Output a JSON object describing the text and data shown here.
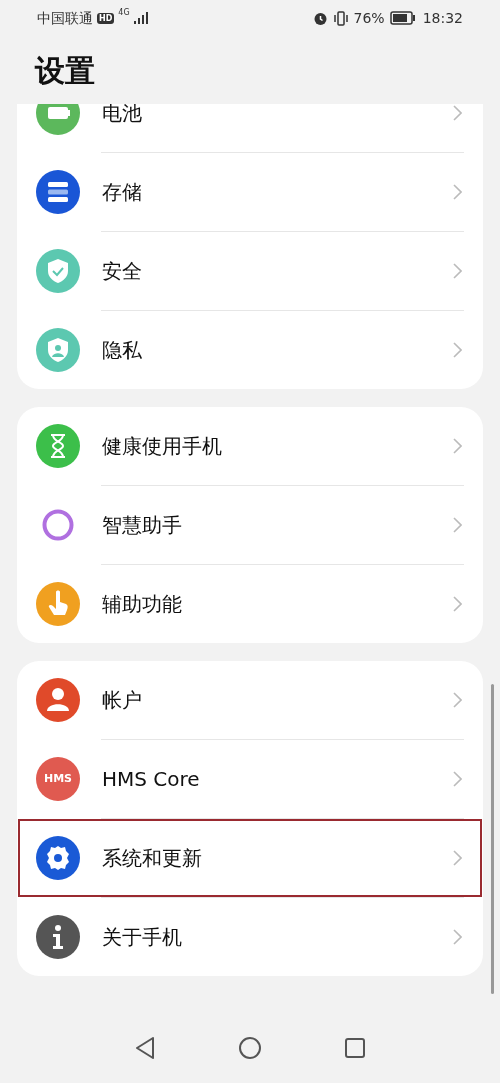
{
  "status_bar": {
    "carrier": "中国联通",
    "hd_badge": "HD",
    "network": "4G",
    "battery_percent": "76%",
    "time": "18:32"
  },
  "title": "设置",
  "groups": [
    {
      "items": [
        {
          "label": "电池",
          "kind": "battery",
          "color": "#5cb85c",
          "highlighted": false
        },
        {
          "label": "存储",
          "kind": "storage",
          "color": "#1a56d6",
          "highlighted": false
        },
        {
          "label": "安全",
          "kind": "shield",
          "color": "#5cc8b0",
          "highlighted": false
        },
        {
          "label": "隐私",
          "kind": "privacy",
          "color": "#5cc8b0",
          "highlighted": false
        }
      ]
    },
    {
      "items": [
        {
          "label": "健康使用手机",
          "kind": "hourglass",
          "color": "#3cbf4a",
          "highlighted": false
        },
        {
          "label": "智慧助手",
          "kind": "ring",
          "color": "#b070e0",
          "highlighted": false
        },
        {
          "label": "辅助功能",
          "kind": "hand",
          "color": "#f0a020",
          "highlighted": false
        }
      ]
    },
    {
      "items": [
        {
          "label": "帐户",
          "kind": "person",
          "color": "#e04a2a",
          "highlighted": false
        },
        {
          "label": "HMS Core",
          "kind": "hms",
          "icon_text": "HMS",
          "color": "#e05a50",
          "highlighted": false
        },
        {
          "label": "系统和更新",
          "kind": "gear",
          "color": "#1a5ad6",
          "highlighted": true
        },
        {
          "label": "关于手机",
          "kind": "info",
          "color": "#555555",
          "highlighted": false
        }
      ]
    }
  ]
}
